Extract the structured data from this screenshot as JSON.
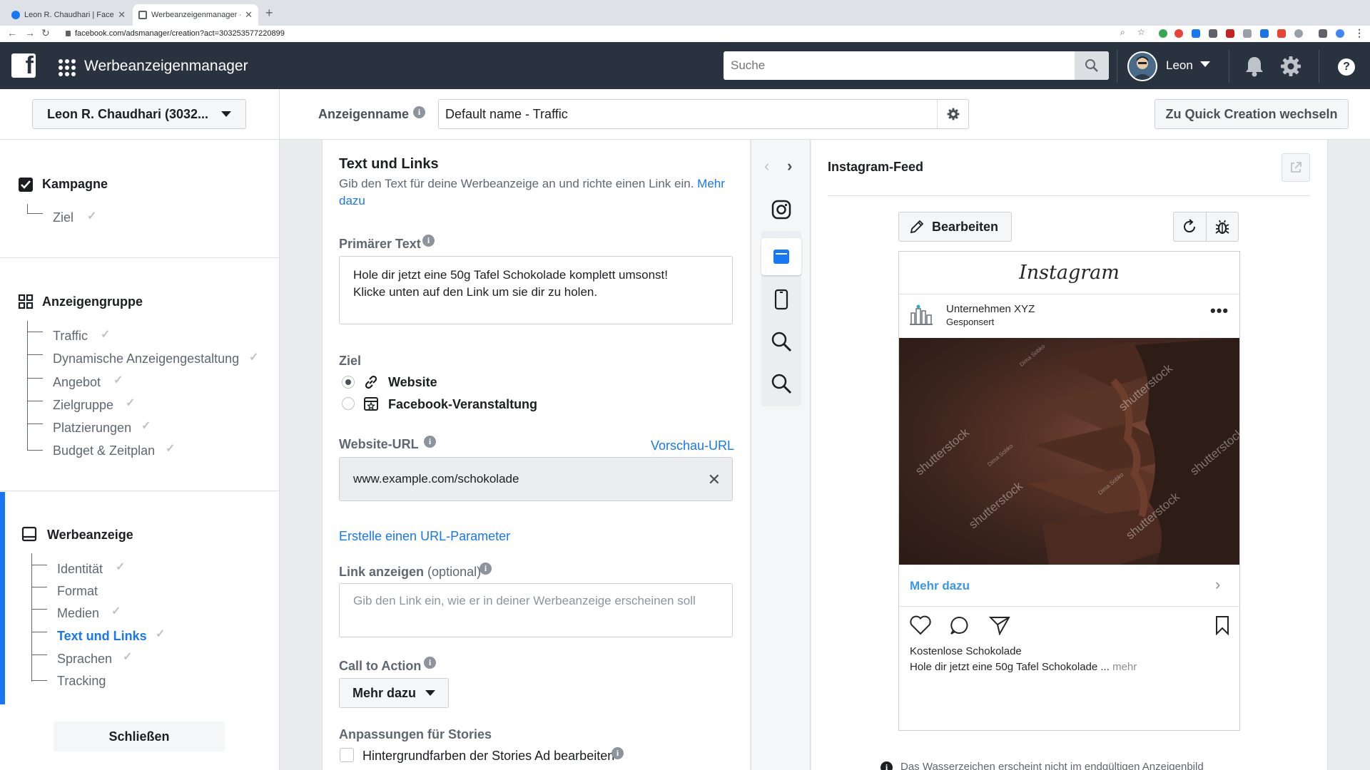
{
  "browser": {
    "tabs": [
      {
        "title": "Leon R. Chaudhari | Facebook"
      },
      {
        "title": "Werbeanzeigenmanager - Cre..."
      }
    ],
    "url": "facebook.com/adsmanager/creation?act=303253577220899"
  },
  "header": {
    "app_name": "Werbeanzeigenmanager",
    "search_placeholder": "Suche",
    "user_name": "Leon"
  },
  "subheader": {
    "account": "Leon R. Chaudhari (3032...",
    "ad_name_label": "Anzeigenname",
    "ad_name_value": "Default name - Traffic",
    "quick_creation": "Zu Quick Creation wechseln"
  },
  "sidebar": {
    "sections": [
      {
        "title": "Kampagne",
        "items": [
          "Ziel"
        ]
      },
      {
        "title": "Anzeigengruppe",
        "items": [
          "Traffic",
          "Dynamische Anzeigengestaltung",
          "Angebot",
          "Zielgruppe",
          "Platzierungen",
          "Budget & Zeitplan"
        ]
      },
      {
        "title": "Werbeanzeige",
        "items": [
          "Identität",
          "Format",
          "Medien",
          "Text und Links",
          "Sprachen",
          "Tracking"
        ],
        "active_item": "Text und Links"
      }
    ],
    "close_button": "Schließen"
  },
  "form": {
    "title": "Text und Links",
    "subtitle": "Gib den Text für deine Werbeanzeige an und richte einen Link ein.",
    "subtitle_link": "Mehr dazu",
    "primary_text_label": "Primärer Text",
    "primary_text_line1": "Hole dir jetzt eine 50g Tafel Schokolade komplett umsonst!",
    "primary_text_line2": "Klicke unten auf den Link um sie dir zu holen.",
    "goal_label": "Ziel",
    "goal_options": [
      "Website",
      "Facebook-Veranstaltung"
    ],
    "goal_selected": "Website",
    "website_url_label": "Website-URL",
    "preview_url_link": "Vorschau-URL",
    "website_url_value": "www.example.com/schokolade",
    "url_param_link": "Erstelle einen URL-Parameter",
    "display_link_label": "Link anzeigen",
    "display_link_optional": "(optional)",
    "display_link_placeholder": "Gib den Link ein, wie er in deiner Werbeanzeige erscheinen soll",
    "cta_label": "Call to Action",
    "cta_value": "Mehr dazu",
    "stories_label": "Anpassungen für Stories",
    "stories_checkbox": "Hintergrundfarben der Stories Ad bearbeiten"
  },
  "preview": {
    "title": "Instagram-Feed",
    "edit_button": "Bearbeiten",
    "ig_logo": "Instagram",
    "company": "Unternehmen XYZ",
    "sponsored": "Gesponsert",
    "watermark": "shutterstock",
    "watermark_small": "Dima Sobko",
    "cta": "Mehr dazu",
    "caption_title": "Kostenlose Schokolade",
    "caption_text": "Hole dir jetzt eine 50g Tafel Schokolade ...",
    "caption_more": "mehr",
    "watermark_note": "Das Wasserzeichen erscheint nicht im endgültigen Anzeigenbild"
  },
  "colors": {
    "fb_header": "#29323f",
    "accent": "#1877f2"
  }
}
